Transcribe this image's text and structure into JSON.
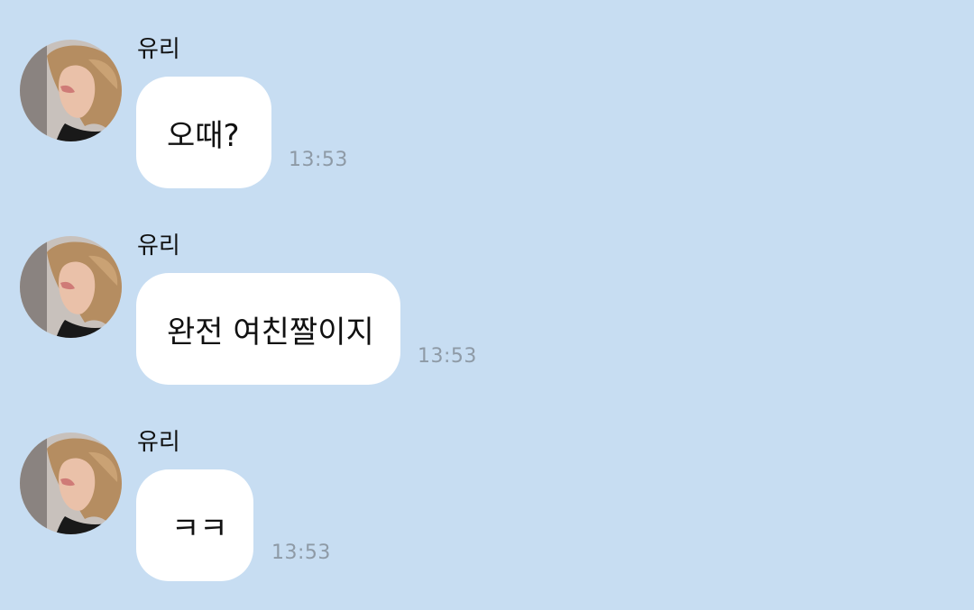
{
  "messages": [
    {
      "sender": "유리",
      "avatar_icon": "profile-photo-icon",
      "text": "오때?",
      "time": "13:53"
    },
    {
      "sender": "유리",
      "avatar_icon": "profile-photo-icon",
      "text": "완전 여친짤이지",
      "time": "13:53"
    },
    {
      "sender": "유리",
      "avatar_icon": "profile-photo-icon",
      "text": "ㅋㅋ",
      "time": "13:53"
    }
  ],
  "colors": {
    "background": "#c7ddf2",
    "bubble": "#ffffff",
    "timestamp": "#8e9aa6",
    "text": "#111111"
  }
}
